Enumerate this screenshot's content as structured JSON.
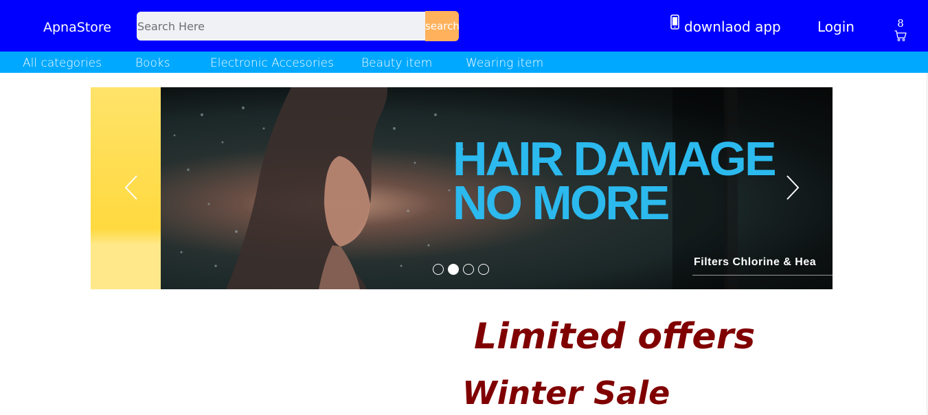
{
  "header": {
    "brand": "ApnaStore",
    "search": {
      "placeholder": "Search Here",
      "button_label": "search"
    },
    "app_link": {
      "icon": "mobile-phone-icon",
      "label": "downlaod app"
    },
    "login_label": "Login",
    "cart": {
      "count": "8",
      "icon": "shopping-cart-icon"
    }
  },
  "categories": [
    "All categories",
    "Books",
    "Electronic Accesories",
    "Beauty item",
    "Wearing item"
  ],
  "carousel": {
    "headline_line1": "HAIR DAMAGE",
    "headline_line2": "NO MORE",
    "subtext": "Filters Chlorine & Hea",
    "slide_count": 4,
    "active_slide": 2
  },
  "promo": {
    "title": "Limited offers",
    "subtitle": "Winter Sale"
  },
  "colors": {
    "header": "#0000ff",
    "category_bar": "#00a8ff",
    "search_button": "#ffb15b",
    "headline": "#2bb9ee",
    "promo_text": "#800000"
  }
}
